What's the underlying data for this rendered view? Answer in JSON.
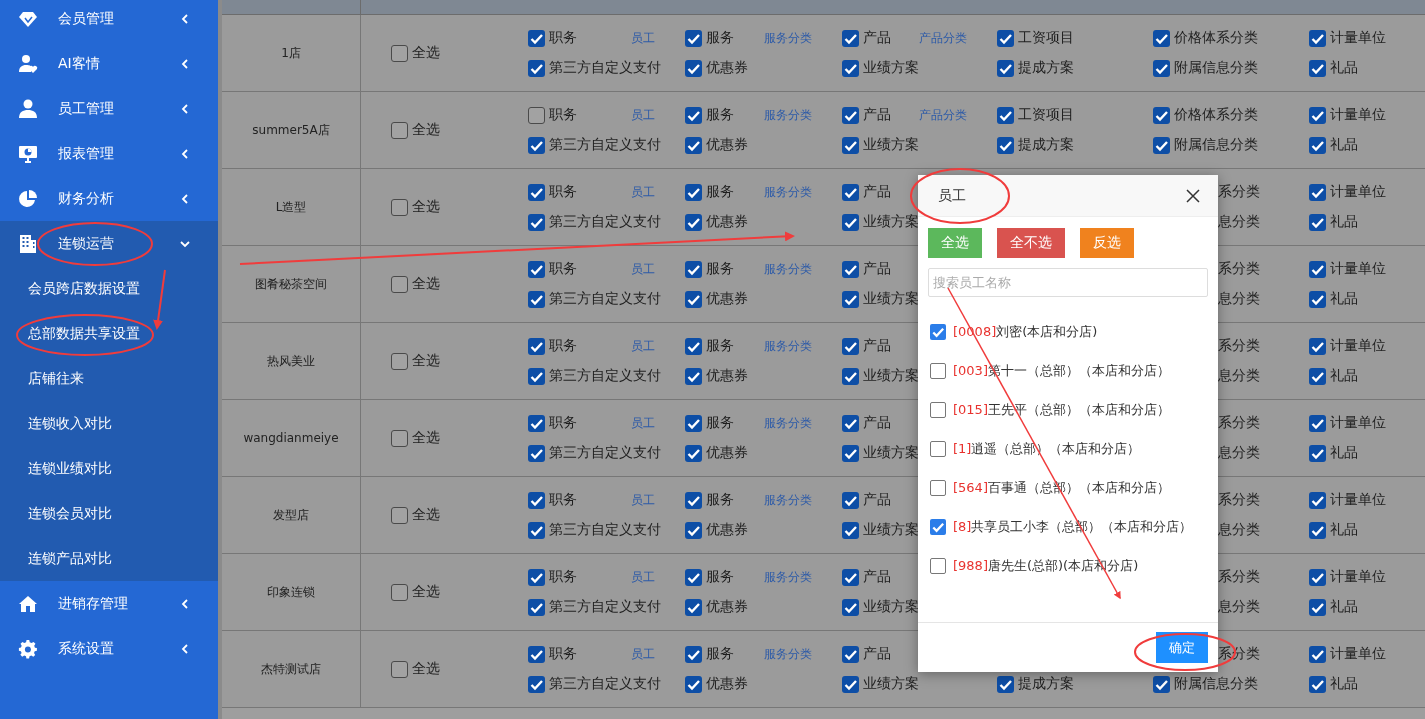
{
  "sidebar": {
    "items": [
      {
        "label": "会员管理",
        "expanded": false
      },
      {
        "label": "AI客情",
        "expanded": false
      },
      {
        "label": "员工管理",
        "expanded": false
      },
      {
        "label": "报表管理",
        "expanded": false
      },
      {
        "label": "财务分析",
        "expanded": false
      },
      {
        "label": "连锁运营",
        "expanded": true,
        "children": [
          {
            "label": "会员跨店数据设置"
          },
          {
            "label": "总部数据共享设置"
          },
          {
            "label": "店铺往来"
          },
          {
            "label": "连锁收入对比"
          },
          {
            "label": "连锁业绩对比"
          },
          {
            "label": "连锁会员对比"
          },
          {
            "label": "连锁产品对比"
          }
        ]
      },
      {
        "label": "进销存管理",
        "expanded": false
      },
      {
        "label": "系统设置",
        "expanded": false
      }
    ]
  },
  "table": {
    "rows": [
      {
        "store": "1店",
        "select_all": {
          "label": "全选",
          "checked": false
        },
        "fields": {
          "duty": {
            "top": {
              "kind": "check",
              "label": "职务",
              "checked": true
            },
            "bottom": {
              "kind": "check",
              "label": "第三方自定义支付",
              "checked": true
            },
            "link": "员工"
          },
          "service": {
            "top": {
              "kind": "check",
              "label": "服务",
              "checked": true
            },
            "bottom": {
              "kind": "check",
              "label": "优惠券",
              "checked": true
            },
            "link": "服务分类"
          },
          "product": {
            "top": {
              "kind": "check",
              "label": "产品",
              "checked": true
            },
            "bottom": {
              "kind": "check",
              "label": "业绩方案",
              "checked": true
            },
            "link": "产品分类"
          },
          "wage": {
            "top": {
              "kind": "check",
              "label": "工资项目",
              "checked": true
            },
            "bottom": {
              "kind": "check",
              "label": "提成方案",
              "checked": true
            }
          },
          "price": {
            "top": {
              "kind": "check",
              "label": "价格体系分类",
              "checked": true
            },
            "bottom": {
              "kind": "check",
              "label": "附属信息分类",
              "checked": true
            }
          },
          "unit": {
            "top": {
              "kind": "check",
              "label": "计量单位",
              "checked": true
            },
            "bottom": {
              "kind": "check",
              "label": "礼品",
              "checked": true
            }
          }
        }
      },
      {
        "store": "summer5A店",
        "select_all": {
          "label": "全选",
          "checked": false
        },
        "fields": {
          "duty": {
            "top": {
              "kind": "check",
              "label": "职务",
              "checked": false
            },
            "bottom": {
              "kind": "check",
              "label": "第三方自定义支付",
              "checked": true
            },
            "link": "员工"
          },
          "service": {
            "top": {
              "kind": "check",
              "label": "服务",
              "checked": true
            },
            "bottom": {
              "kind": "check",
              "label": "优惠券",
              "checked": true
            },
            "link": "服务分类"
          },
          "product": {
            "top": {
              "kind": "check",
              "label": "产品",
              "checked": true
            },
            "bottom": {
              "kind": "check",
              "label": "业绩方案",
              "checked": true
            },
            "link": "产品分类"
          },
          "wage": {
            "top": {
              "kind": "check",
              "label": "工资项目",
              "checked": true
            },
            "bottom": {
              "kind": "check",
              "label": "提成方案",
              "checked": true
            }
          },
          "price": {
            "top": {
              "kind": "check",
              "label": "价格体系分类",
              "checked": true
            },
            "bottom": {
              "kind": "check",
              "label": "附属信息分类",
              "checked": true
            }
          },
          "unit": {
            "top": {
              "kind": "check",
              "label": "计量单位",
              "checked": true
            },
            "bottom": {
              "kind": "check",
              "label": "礼品",
              "checked": true
            }
          }
        }
      },
      {
        "store": "L造型",
        "select_all": {
          "label": "全选",
          "checked": false
        },
        "fields": {
          "duty": {
            "top": {
              "kind": "check",
              "label": "职务",
              "checked": true
            },
            "bottom": {
              "kind": "check",
              "label": "第三方自定义支付",
              "checked": true
            },
            "link": "员工"
          },
          "service": {
            "top": {
              "kind": "check",
              "label": "服务",
              "checked": true
            },
            "bottom": {
              "kind": "check",
              "label": "优惠券",
              "checked": true
            },
            "link": "服务分类"
          },
          "product": {
            "top": {
              "kind": "check",
              "label": "产品",
              "checked": true
            },
            "bottom": {
              "kind": "check",
              "label": "业绩方案",
              "checked": true
            }
          },
          "price": {
            "top": {
              "kind": "fragment",
              "label": "系分类"
            },
            "bottom": {
              "kind": "fragment",
              "label": "息分类"
            }
          },
          "unit": {
            "top": {
              "kind": "check",
              "label": "计量单位",
              "checked": true
            },
            "bottom": {
              "kind": "check",
              "label": "礼品",
              "checked": true
            }
          }
        }
      },
      {
        "store": "图肴秘茶空间",
        "select_all": {
          "label": "全选",
          "checked": false
        },
        "fields": {
          "duty": {
            "top": {
              "kind": "check",
              "label": "职务",
              "checked": true
            },
            "bottom": {
              "kind": "check",
              "label": "第三方自定义支付",
              "checked": true
            },
            "link": "员工"
          },
          "service": {
            "top": {
              "kind": "check",
              "label": "服务",
              "checked": true
            },
            "bottom": {
              "kind": "check",
              "label": "优惠券",
              "checked": true
            },
            "link": "服务分类"
          },
          "product": {
            "top": {
              "kind": "check",
              "label": "产品",
              "checked": true
            },
            "bottom": {
              "kind": "check",
              "label": "业绩方案",
              "checked": true
            }
          },
          "price": {
            "top": {
              "kind": "fragment",
              "label": "系分类"
            },
            "bottom": {
              "kind": "fragment",
              "label": "息分类"
            }
          },
          "unit": {
            "top": {
              "kind": "check",
              "label": "计量单位",
              "checked": true
            },
            "bottom": {
              "kind": "check",
              "label": "礼品",
              "checked": true
            }
          }
        }
      },
      {
        "store": "热风美业",
        "select_all": {
          "label": "全选",
          "checked": false
        },
        "fields": {
          "duty": {
            "top": {
              "kind": "check",
              "label": "职务",
              "checked": true
            },
            "bottom": {
              "kind": "check",
              "label": "第三方自定义支付",
              "checked": true
            },
            "link": "员工"
          },
          "service": {
            "top": {
              "kind": "check",
              "label": "服务",
              "checked": true
            },
            "bottom": {
              "kind": "check",
              "label": "优惠券",
              "checked": true
            },
            "link": "服务分类"
          },
          "product": {
            "top": {
              "kind": "check",
              "label": "产品",
              "checked": true
            },
            "bottom": {
              "kind": "check",
              "label": "业绩方案",
              "checked": true
            }
          },
          "price": {
            "top": {
              "kind": "fragment",
              "label": "系分类"
            },
            "bottom": {
              "kind": "fragment",
              "label": "息分类"
            }
          },
          "unit": {
            "top": {
              "kind": "check",
              "label": "计量单位",
              "checked": true
            },
            "bottom": {
              "kind": "check",
              "label": "礼品",
              "checked": true
            }
          }
        }
      },
      {
        "store": "wangdianmeiye",
        "select_all": {
          "label": "全选",
          "checked": false
        },
        "fields": {
          "duty": {
            "top": {
              "kind": "check",
              "label": "职务",
              "checked": true
            },
            "bottom": {
              "kind": "check",
              "label": "第三方自定义支付",
              "checked": true
            },
            "link": "员工"
          },
          "service": {
            "top": {
              "kind": "check",
              "label": "服务",
              "checked": true
            },
            "bottom": {
              "kind": "check",
              "label": "优惠券",
              "checked": true
            },
            "link": "服务分类"
          },
          "product": {
            "top": {
              "kind": "check",
              "label": "产品",
              "checked": true
            },
            "bottom": {
              "kind": "check",
              "label": "业绩方案",
              "checked": true
            }
          },
          "price": {
            "top": {
              "kind": "fragment",
              "label": "系分类"
            },
            "bottom": {
              "kind": "fragment",
              "label": "息分类"
            }
          },
          "unit": {
            "top": {
              "kind": "check",
              "label": "计量单位",
              "checked": true
            },
            "bottom": {
              "kind": "check",
              "label": "礼品",
              "checked": true
            }
          }
        }
      },
      {
        "store": "发型店",
        "select_all": {
          "label": "全选",
          "checked": false
        },
        "fields": {
          "duty": {
            "top": {
              "kind": "check",
              "label": "职务",
              "checked": true
            },
            "bottom": {
              "kind": "check",
              "label": "第三方自定义支付",
              "checked": true
            },
            "link": "员工"
          },
          "service": {
            "top": {
              "kind": "check",
              "label": "服务",
              "checked": true
            },
            "bottom": {
              "kind": "check",
              "label": "优惠券",
              "checked": true
            },
            "link": "服务分类"
          },
          "product": {
            "top": {
              "kind": "check",
              "label": "产品",
              "checked": true
            },
            "bottom": {
              "kind": "check",
              "label": "业绩方案",
              "checked": true
            }
          },
          "price": {
            "top": {
              "kind": "fragment",
              "label": "系分类"
            },
            "bottom": {
              "kind": "fragment",
              "label": "息分类"
            }
          },
          "unit": {
            "top": {
              "kind": "check",
              "label": "计量单位",
              "checked": true
            },
            "bottom": {
              "kind": "check",
              "label": "礼品",
              "checked": true
            }
          }
        }
      },
      {
        "store": "印象连锁",
        "select_all": {
          "label": "全选",
          "checked": false
        },
        "fields": {
          "duty": {
            "top": {
              "kind": "check",
              "label": "职务",
              "checked": true
            },
            "bottom": {
              "kind": "check",
              "label": "第三方自定义支付",
              "checked": true
            },
            "link": "员工"
          },
          "service": {
            "top": {
              "kind": "check",
              "label": "服务",
              "checked": true
            },
            "bottom": {
              "kind": "check",
              "label": "优惠券",
              "checked": true
            },
            "link": "服务分类"
          },
          "product": {
            "top": {
              "kind": "check",
              "label": "产品",
              "checked": true
            },
            "bottom": {
              "kind": "check",
              "label": "业绩方案",
              "checked": true
            }
          },
          "price": {
            "top": {
              "kind": "fragment",
              "label": "系分类"
            },
            "bottom": {
              "kind": "fragment",
              "label": "息分类"
            }
          },
          "unit": {
            "top": {
              "kind": "check",
              "label": "计量单位",
              "checked": true
            },
            "bottom": {
              "kind": "check",
              "label": "礼品",
              "checked": true
            }
          }
        }
      },
      {
        "store": "杰特测试店",
        "select_all": {
          "label": "全选",
          "checked": false
        },
        "fields": {
          "duty": {
            "top": {
              "kind": "check",
              "label": "职务",
              "checked": true
            },
            "bottom": {
              "kind": "check",
              "label": "第三方自定义支付",
              "checked": true
            },
            "link": "员工"
          },
          "service": {
            "top": {
              "kind": "check",
              "label": "服务",
              "checked": true
            },
            "bottom": {
              "kind": "check",
              "label": "优惠券",
              "checked": true
            },
            "link": "服务分类"
          },
          "product": {
            "top": {
              "kind": "check",
              "label": "产品",
              "checked": true
            },
            "bottom": {
              "kind": "check",
              "label": "业绩方案",
              "checked": true
            }
          },
          "wage": {
            "bottom": {
              "kind": "check",
              "label": "提成方案",
              "checked": true
            }
          },
          "price": {
            "top": {
              "kind": "fragment",
              "label": "系分类"
            },
            "bottom": {
              "kind": "check",
              "label": "附属信息分类",
              "checked": true
            }
          },
          "unit": {
            "top": {
              "kind": "check",
              "label": "计量单位",
              "checked": true
            },
            "bottom": {
              "kind": "check",
              "label": "礼品",
              "checked": true
            }
          }
        }
      }
    ]
  },
  "dialog": {
    "title": "员工",
    "buttons": [
      {
        "label": "全选",
        "kind": "all"
      },
      {
        "label": "全不选",
        "kind": "none"
      },
      {
        "label": "反选",
        "kind": "invert"
      }
    ],
    "search": {
      "placeholder": "搜索员工名称"
    },
    "options": [
      {
        "code": "[0008]",
        "name": "刘密(本店和分店)",
        "checked": true
      },
      {
        "code": "[003]",
        "name": "第十一（总部）（本店和分店）",
        "checked": false
      },
      {
        "code": "[015]",
        "name": "王先平（总部）（本店和分店）",
        "checked": false
      },
      {
        "code": "[1]",
        "name": "逍遥（总部）（本店和分店）",
        "checked": false
      },
      {
        "code": "[564]",
        "name": "百事通（总部）（本店和分店）",
        "checked": false
      },
      {
        "code": "[8]",
        "name": "共享员工小李（总部）（本店和分店）",
        "checked": true
      },
      {
        "code": "[988]",
        "name": "唐先生(总部)(本店和分店)",
        "checked": false
      }
    ],
    "confirm": "确定"
  }
}
